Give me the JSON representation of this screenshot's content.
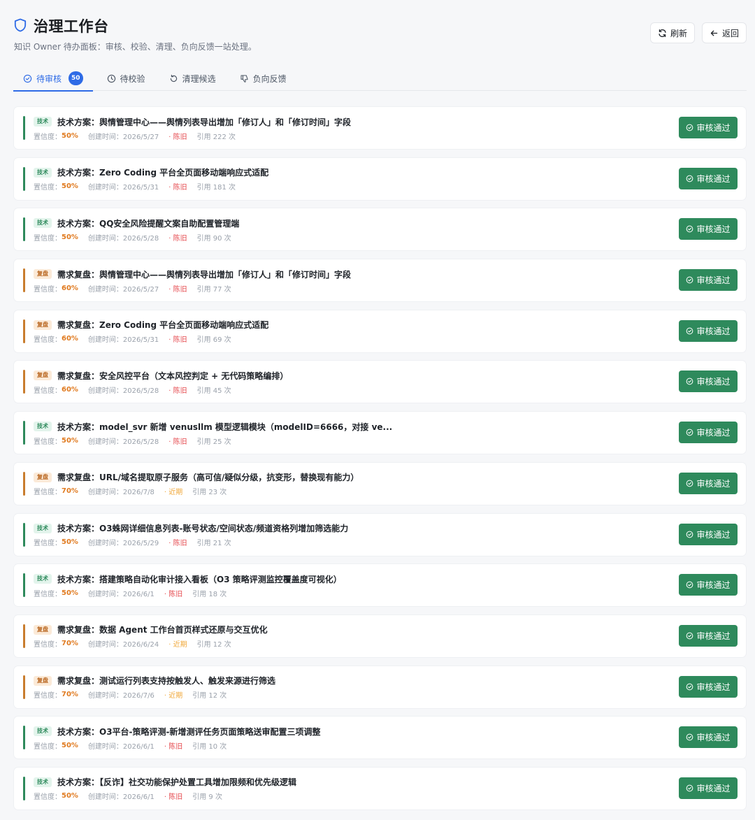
{
  "header": {
    "title": "治理工作台",
    "subtitle": "知识 Owner 待办面板：审核、校验、清理、负向反馈一站处理。",
    "refresh_label": "刷新",
    "back_label": "返回"
  },
  "tabs": [
    {
      "label": "待审核",
      "badge": "50",
      "icon": "check-circle-icon",
      "active": true
    },
    {
      "label": "待校验",
      "icon": "clock-icon",
      "active": false
    },
    {
      "label": "清理候选",
      "icon": "rotate-ccw-icon",
      "active": false
    },
    {
      "label": "负向反馈",
      "icon": "thumbs-down-icon",
      "active": false
    }
  ],
  "colors": {
    "accent_blue": "#2e6be6",
    "tech_green": "#2e8a5c",
    "review_orange": "#c97d2e",
    "stale_red": "#e5484d",
    "recent_amber": "#f0a83a"
  },
  "list_labels": {
    "confidence_prefix": "置信度：",
    "created_prefix": "创建时间：",
    "approve_label": "审核通过"
  },
  "items": [
    {
      "tag": "技术",
      "kind": "tech",
      "title": "技术方案：舆情管理中心——舆情列表导出增加「修订人」和「修订时间」字段",
      "confidence": "50%",
      "created": "2026/5/27",
      "freshness": "· 陈旧",
      "fresh_kind": "old",
      "refs": "引用 222 次"
    },
    {
      "tag": "技术",
      "kind": "tech",
      "title": "技术方案：Zero Coding 平台全页面移动端响应式适配",
      "confidence": "50%",
      "created": "2026/5/31",
      "freshness": "· 陈旧",
      "fresh_kind": "old",
      "refs": "引用 181 次"
    },
    {
      "tag": "技术",
      "kind": "tech",
      "title": "技术方案：QQ安全风险提醒文案自助配置管理端",
      "confidence": "50%",
      "created": "2026/5/28",
      "freshness": "· 陈旧",
      "fresh_kind": "old",
      "refs": "引用 90 次"
    },
    {
      "tag": "复盘",
      "kind": "review",
      "title": "需求复盘：舆情管理中心——舆情列表导出增加「修订人」和「修订时间」字段",
      "confidence": "60%",
      "created": "2026/5/27",
      "freshness": "· 陈旧",
      "fresh_kind": "old",
      "refs": "引用 77 次"
    },
    {
      "tag": "复盘",
      "kind": "review",
      "title": "需求复盘：Zero Coding 平台全页面移动端响应式适配",
      "confidence": "60%",
      "created": "2026/5/31",
      "freshness": "· 陈旧",
      "fresh_kind": "old",
      "refs": "引用 69 次"
    },
    {
      "tag": "复盘",
      "kind": "review",
      "title": "需求复盘：安全风控平台（文本风控判定 + 无代码策略编排）",
      "confidence": "60%",
      "created": "2026/5/28",
      "freshness": "· 陈旧",
      "fresh_kind": "old",
      "refs": "引用 45 次"
    },
    {
      "tag": "技术",
      "kind": "tech",
      "title": "技术方案：model_svr 新增 venusllm 模型逻辑模块（modelID=6666，对接 ve...",
      "confidence": "50%",
      "created": "2026/5/28",
      "freshness": "· 陈旧",
      "fresh_kind": "old",
      "refs": "引用 25 次"
    },
    {
      "tag": "复盘",
      "kind": "review",
      "title": "需求复盘：URL/域名提取原子服务（高可信/疑似分级，抗变形，替换现有能力）",
      "confidence": "70%",
      "created": "2026/7/8",
      "freshness": "· 近期",
      "fresh_kind": "recent",
      "refs": "引用 23 次"
    },
    {
      "tag": "技术",
      "kind": "tech",
      "title": "技术方案：O3蛛网详细信息列表-账号状态/空间状态/频道资格列增加筛选能力",
      "confidence": "50%",
      "created": "2026/5/29",
      "freshness": "· 陈旧",
      "fresh_kind": "old",
      "refs": "引用 21 次"
    },
    {
      "tag": "技术",
      "kind": "tech",
      "title": "技术方案：搭建策略自动化审计接入看板（O3 策略评测监控覆盖度可视化）",
      "confidence": "50%",
      "created": "2026/6/1",
      "freshness": "· 陈旧",
      "fresh_kind": "old",
      "refs": "引用 18 次"
    },
    {
      "tag": "复盘",
      "kind": "review",
      "title": "需求复盘：数据 Agent 工作台首页样式还原与交互优化",
      "confidence": "70%",
      "created": "2026/6/24",
      "freshness": "· 近期",
      "fresh_kind": "recent",
      "refs": "引用 12 次"
    },
    {
      "tag": "复盘",
      "kind": "review",
      "title": "需求复盘：测试运行列表支持按触发人、触发来源进行筛选",
      "confidence": "70%",
      "created": "2026/7/6",
      "freshness": "· 近期",
      "fresh_kind": "recent",
      "refs": "引用 12 次"
    },
    {
      "tag": "技术",
      "kind": "tech",
      "title": "技术方案：O3平台-策略评测-新增测评任务页面策略送审配置三项调整",
      "confidence": "50%",
      "created": "2026/6/1",
      "freshness": "· 陈旧",
      "fresh_kind": "old",
      "refs": "引用 10 次"
    },
    {
      "tag": "技术",
      "kind": "tech",
      "title": "技术方案：【反诈】社交功能保护处置工具增加限频和优先级逻辑",
      "confidence": "50%",
      "created": "2026/6/1",
      "freshness": "· 陈旧",
      "fresh_kind": "old",
      "refs": "引用 9 次"
    }
  ]
}
